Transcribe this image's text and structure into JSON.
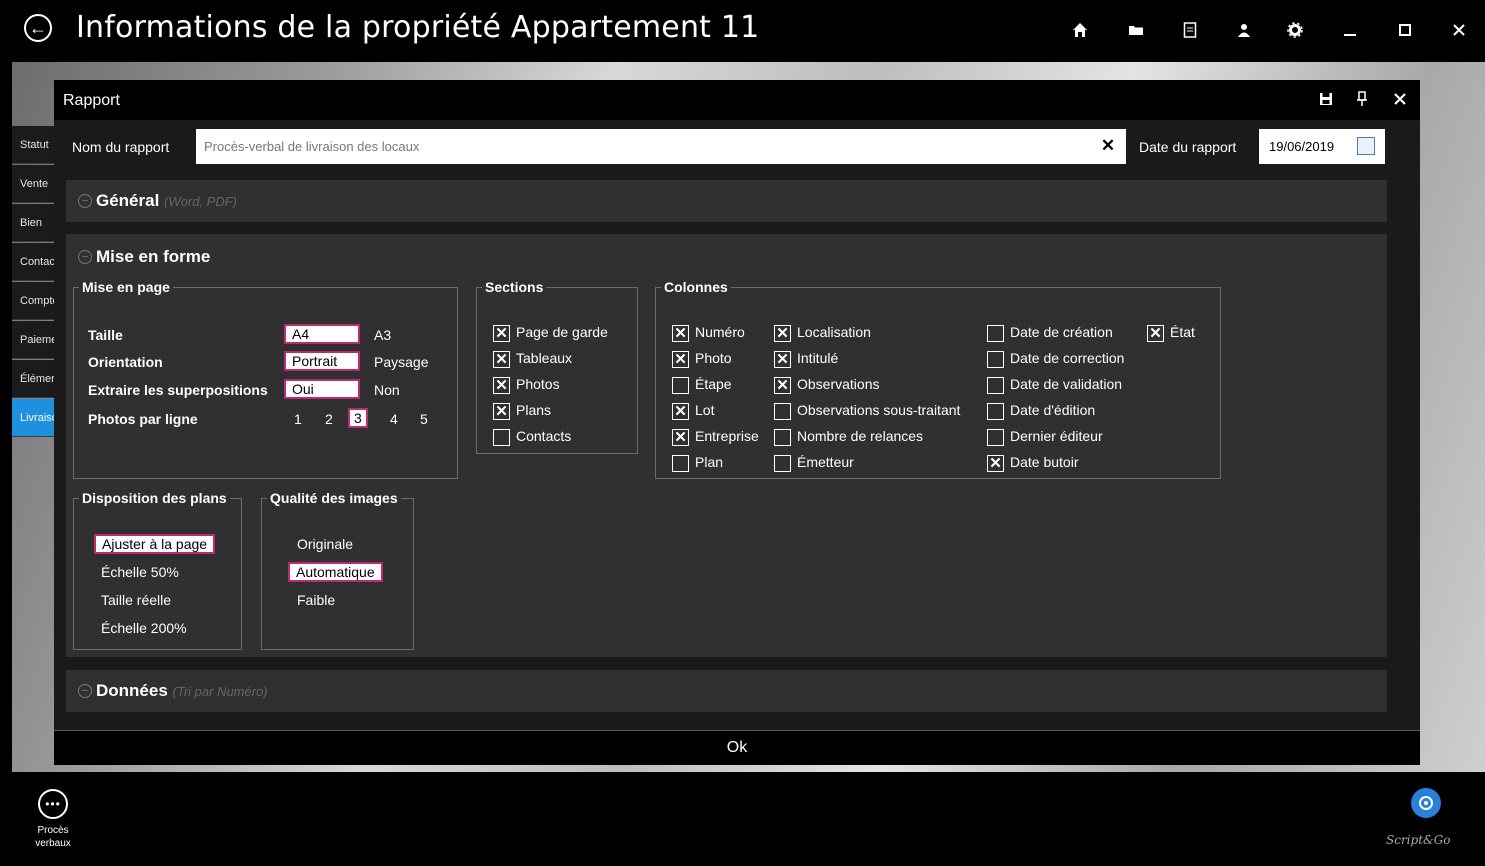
{
  "window": {
    "title": "Informations de la propriété Appartement 11",
    "icons": [
      "home-icon",
      "folder-icon",
      "document-icon",
      "user-icon",
      "gear-icon",
      "minimize-icon",
      "maximize-icon",
      "close-icon"
    ]
  },
  "sidebar": {
    "items": [
      {
        "label": "Statut"
      },
      {
        "label": "Vente"
      },
      {
        "label": "Bien"
      },
      {
        "label": "Contacts"
      },
      {
        "label": "Compteurs"
      },
      {
        "label": "Paiements"
      },
      {
        "label": "Éléments"
      },
      {
        "label": "Livraison"
      }
    ]
  },
  "dialog": {
    "title": "Rapport",
    "name_label": "Nom du rapport",
    "name_value": "Procès-verbal de livraison des locaux",
    "clear_label": "✕",
    "date_label": "Date du rapport",
    "date_value": "19/06/2019",
    "general": {
      "title": "Général",
      "subtitle": "(Word, PDF)"
    },
    "mise_en_forme": {
      "title": "Mise en forme",
      "mise_en_page": {
        "legend": "Mise en page",
        "taille": {
          "label": "Taille",
          "options": [
            "A4",
            "A3"
          ],
          "selected": "A4"
        },
        "orientation": {
          "label": "Orientation",
          "options": [
            "Portrait",
            "Paysage"
          ],
          "selected": "Portrait"
        },
        "superpositions": {
          "label": "Extraire les superpositions",
          "options": [
            "Oui",
            "Non"
          ],
          "selected": "Oui"
        },
        "photos_par_ligne": {
          "label": "Photos par ligne",
          "options": [
            "1",
            "2",
            "3",
            "4",
            "5"
          ],
          "selected": "3"
        }
      },
      "sections": {
        "legend": "Sections",
        "items": [
          {
            "label": "Page de garde",
            "checked": true
          },
          {
            "label": "Tableaux",
            "checked": true
          },
          {
            "label": "Photos",
            "checked": true
          },
          {
            "label": "Plans",
            "checked": true
          },
          {
            "label": "Contacts",
            "checked": false
          }
        ]
      },
      "colonnes": {
        "legend": "Colonnes",
        "col1": [
          {
            "label": "Numéro",
            "checked": true
          },
          {
            "label": "Photo",
            "checked": true
          },
          {
            "label": "Étape",
            "checked": false
          },
          {
            "label": "Lot",
            "checked": true
          },
          {
            "label": "Entreprise",
            "checked": true
          },
          {
            "label": "Plan",
            "checked": false
          }
        ],
        "col2": [
          {
            "label": "Localisation",
            "checked": true
          },
          {
            "label": "Intitulé",
            "checked": true
          },
          {
            "label": "Observations",
            "checked": true
          },
          {
            "label": "Observations sous-traitant",
            "checked": false
          },
          {
            "label": "Nombre de relances",
            "checked": false
          },
          {
            "label": "Émetteur",
            "checked": false
          }
        ],
        "col3": [
          {
            "label": "Date de création",
            "checked": false
          },
          {
            "label": "Date de correction",
            "checked": false
          },
          {
            "label": "Date de validation",
            "checked": false
          },
          {
            "label": "Date d'édition",
            "checked": false
          },
          {
            "label": "Dernier éditeur",
            "checked": false
          },
          {
            "label": "Date butoir",
            "checked": true
          }
        ],
        "col4": [
          {
            "label": "État",
            "checked": true
          }
        ]
      },
      "disposition": {
        "legend": "Disposition des plans",
        "options": [
          "Ajuster à la page",
          "Échelle 50%",
          "Taille réelle",
          "Échelle 200%"
        ],
        "selected": "Ajuster à la page"
      },
      "qualite": {
        "legend": "Qualité des images",
        "options": [
          "Originale",
          "Automatique",
          "Faible"
        ],
        "selected": "Automatique"
      }
    },
    "donnees": {
      "title": "Données",
      "subtitle": "(Tri par Numéro)"
    },
    "ok_label": "Ok"
  },
  "bottom": {
    "pv_label_1": "Procès",
    "pv_label_2": "verbaux",
    "brand": "Script&Go"
  },
  "colors": {
    "accent_selection": "#c0296f",
    "active_sidebar": "#1e90e0",
    "panel_bg": "#303030",
    "dialog_bg": "#1a1a1a"
  }
}
